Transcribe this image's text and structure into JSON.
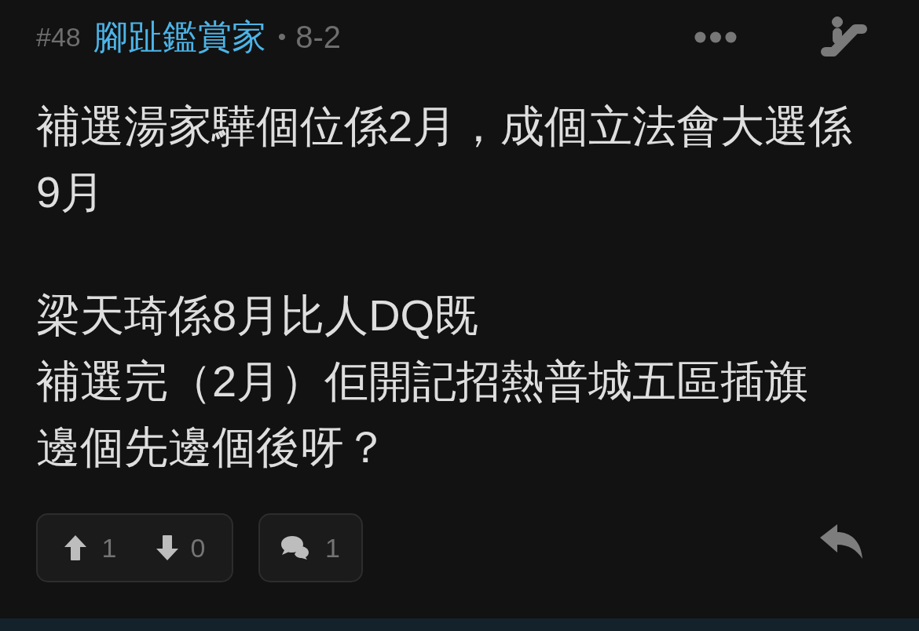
{
  "post": {
    "number": "#48",
    "author": "腳趾鑑賞家",
    "separator": "•",
    "time": "8-2",
    "paragraphs": [
      [
        "補選湯家驊個位係2月，成個立法會大選係9月"
      ],
      [
        "梁天琦係8月比人DQ既",
        "補選完（2月）佢開記招熱普城五區插旗",
        "邊個先邊個後呀？"
      ]
    ],
    "upvotes": "1",
    "downvotes": "0",
    "replies": "1"
  }
}
